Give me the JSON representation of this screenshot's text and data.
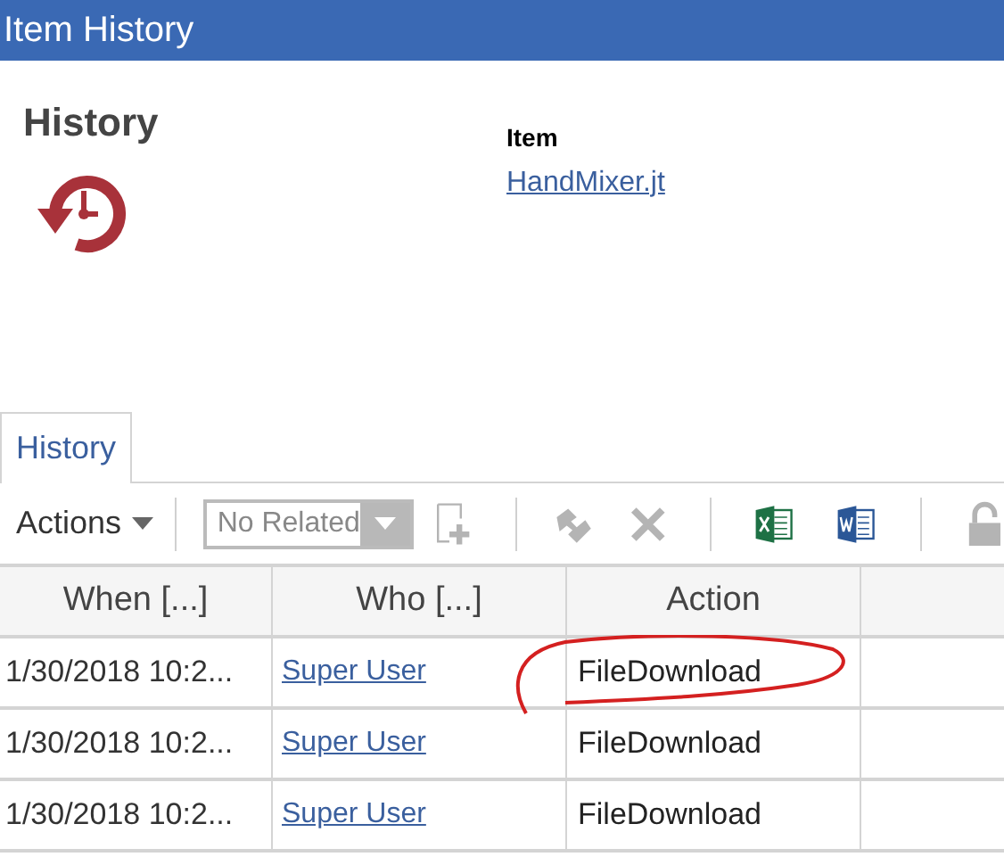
{
  "window": {
    "title": "Item History"
  },
  "header": {
    "heading": "History",
    "item_label": "Item",
    "item_link": "HandMixer.jt"
  },
  "tabs": [
    {
      "label": "History",
      "selected": true
    }
  ],
  "toolbar": {
    "actions_menu": "Actions",
    "related_select": {
      "value": "No Related"
    },
    "tools": [
      {
        "kind": "add",
        "disabled": true
      },
      {
        "kind": "relate",
        "disabled": true
      },
      {
        "kind": "delete",
        "disabled": true
      },
      {
        "kind": "excel",
        "disabled": false
      },
      {
        "kind": "word",
        "disabled": false
      },
      {
        "kind": "lock",
        "disabled": true
      }
    ]
  },
  "table": {
    "columns": [
      "When [...]",
      "Who [...]",
      "Action"
    ],
    "rows": [
      {
        "when": "1/30/2018 10:2...",
        "who": "Super User",
        "action": "FileDownload",
        "circled": true
      },
      {
        "when": "1/30/2018 10:2...",
        "who": "Super User",
        "action": "FileDownload",
        "circled": false
      },
      {
        "when": "1/30/2018 10:2...",
        "who": "Super User",
        "action": "FileDownload",
        "circled": false
      }
    ]
  }
}
